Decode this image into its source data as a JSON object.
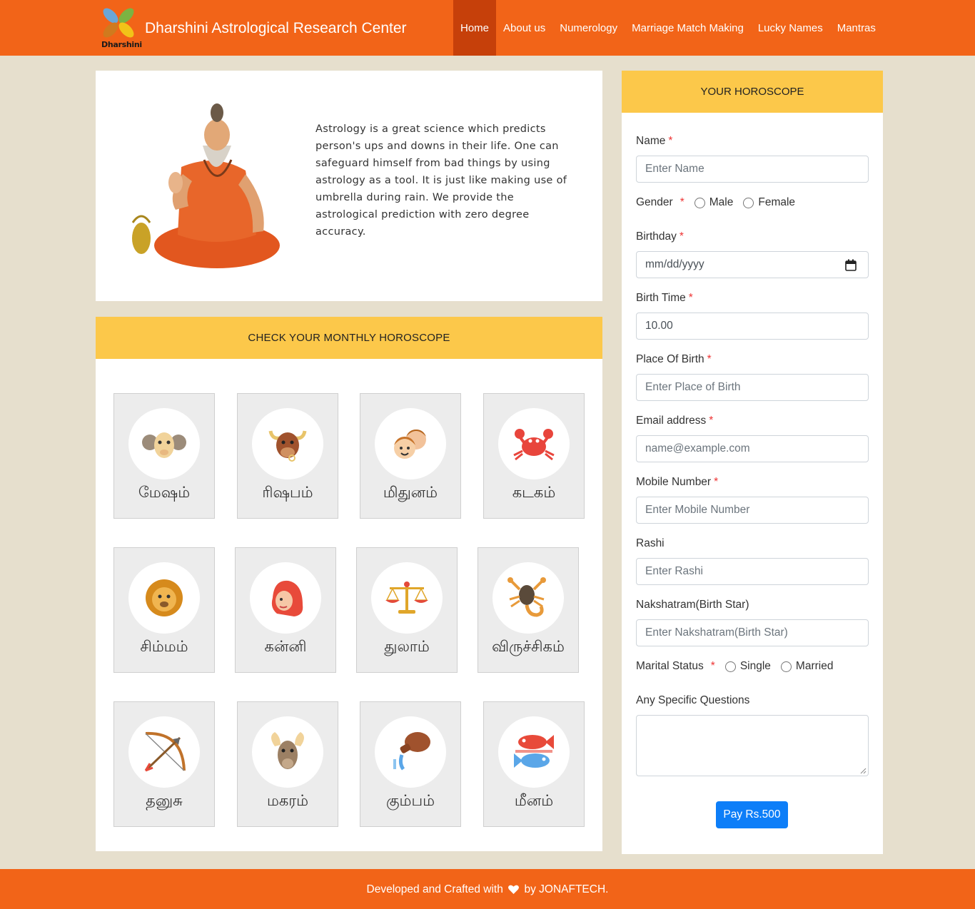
{
  "nav": {
    "brand_title": "Dharshini Astrological Research Center",
    "logo_text": "Dharshini",
    "items": [
      {
        "label": "Home",
        "active": true
      },
      {
        "label": "About us"
      },
      {
        "label": "Numerology"
      },
      {
        "label": "Marriage Match Making"
      },
      {
        "label": "Lucky Names"
      },
      {
        "label": "Mantras"
      }
    ]
  },
  "intro": {
    "text": "Astrology is a great science which predicts person's ups and downs in their life. One can safeguard himself from bad things by using astrology as a tool. It is just like making use of umbrella during rain. We provide the astrological prediction with zero degree accuracy."
  },
  "monthly": {
    "title": "CHECK YOUR MONTHLY HOROSCOPE",
    "signs": [
      {
        "name": "மேஷம்",
        "icon": "ram-icon"
      },
      {
        "name": "ரிஷபம்",
        "icon": "bull-icon"
      },
      {
        "name": "மிதுனம்",
        "icon": "twins-icon"
      },
      {
        "name": "கடகம்",
        "icon": "crab-icon"
      },
      {
        "name": "சிம்மம்",
        "icon": "lion-icon"
      },
      {
        "name": "கன்னி",
        "icon": "maiden-icon"
      },
      {
        "name": "துலாம்",
        "icon": "scales-icon"
      },
      {
        "name": "விருச்சிகம்",
        "icon": "scorpion-icon"
      },
      {
        "name": "தனுசு",
        "icon": "bow-arrow-icon"
      },
      {
        "name": "மகரம்",
        "icon": "goat-icon"
      },
      {
        "name": "கும்பம்",
        "icon": "water-pot-icon"
      },
      {
        "name": "மீனம்",
        "icon": "fish-icon"
      }
    ]
  },
  "form": {
    "title": "YOUR HOROSCOPE",
    "name_label": "Name",
    "name_placeholder": "Enter Name",
    "gender_label": "Gender",
    "gender_options": [
      "Male",
      "Female"
    ],
    "birthday_label": "Birthday",
    "birthday_placeholder": "mm/dd/yyyy",
    "birth_time_label": "Birth Time",
    "birth_time_value": "10.00",
    "place_label": "Place Of Birth",
    "place_placeholder": "Enter Place of Birth",
    "email_label": "Email address",
    "email_placeholder": "name@example.com",
    "mobile_label": "Mobile Number",
    "mobile_placeholder": "Enter Mobile Number",
    "rashi_label": "Rashi",
    "rashi_placeholder": "Enter Rashi",
    "nakshatram_label": "Nakshatram(Birth Star)",
    "nakshatram_placeholder": "Enter Nakshatram(Birth Star)",
    "marital_label": "Marital Status",
    "marital_options": [
      "Single",
      "Married"
    ],
    "questions_label": "Any Specific Questions",
    "required_mark": "*",
    "pay_label": "Pay Rs.500"
  },
  "footer": {
    "before": "Developed and Crafted with",
    "after": "by JONAFTECH."
  },
  "colors": {
    "brand_orange": "#f26418",
    "active_nav": "#c6400a",
    "header_yellow": "#fcc84a",
    "pay_blue": "#0d7ef8",
    "page_bg": "#e6dfcd"
  }
}
